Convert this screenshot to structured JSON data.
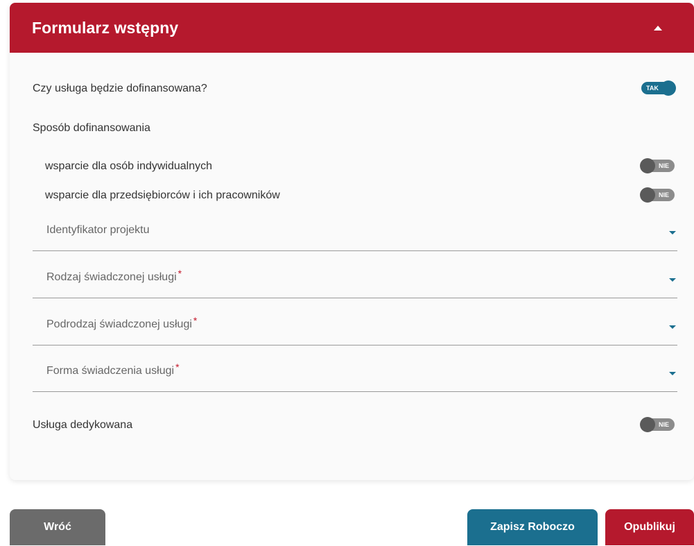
{
  "form": {
    "title": "Formularz wstępny",
    "q_funding": "Czy usługa będzie dofinansowana?",
    "toggle_funding": "TAK",
    "section_funding_method": "Sposób dofinansowania",
    "opt_individual": "wsparcie dla osób indywidualnych",
    "toggle_individual": "NIE",
    "opt_enterprise": "wsparcie dla przedsiębiorców i ich pracowników",
    "toggle_enterprise": "NIE",
    "field_project_id": "Identyfikator projektu",
    "field_service_type": "Rodzaj świadczonej usługi",
    "field_service_subtype": "Podrodzaj świadczonej usługi",
    "field_service_form": "Forma świadczenia usługi",
    "required_mark": "*",
    "q_dedicated": "Usługa dedykowana",
    "toggle_dedicated": "NIE"
  },
  "actions": {
    "back": "Wróć",
    "save_draft": "Zapisz Roboczo",
    "publish": "Opublikuj"
  },
  "colors": {
    "brand_red": "#b5192d",
    "accent_blue": "#1b6f8f",
    "back_gray": "#6b6b6b"
  },
  "icons": {
    "collapse": "caret-up-icon",
    "dropdown": "caret-down-icon"
  }
}
